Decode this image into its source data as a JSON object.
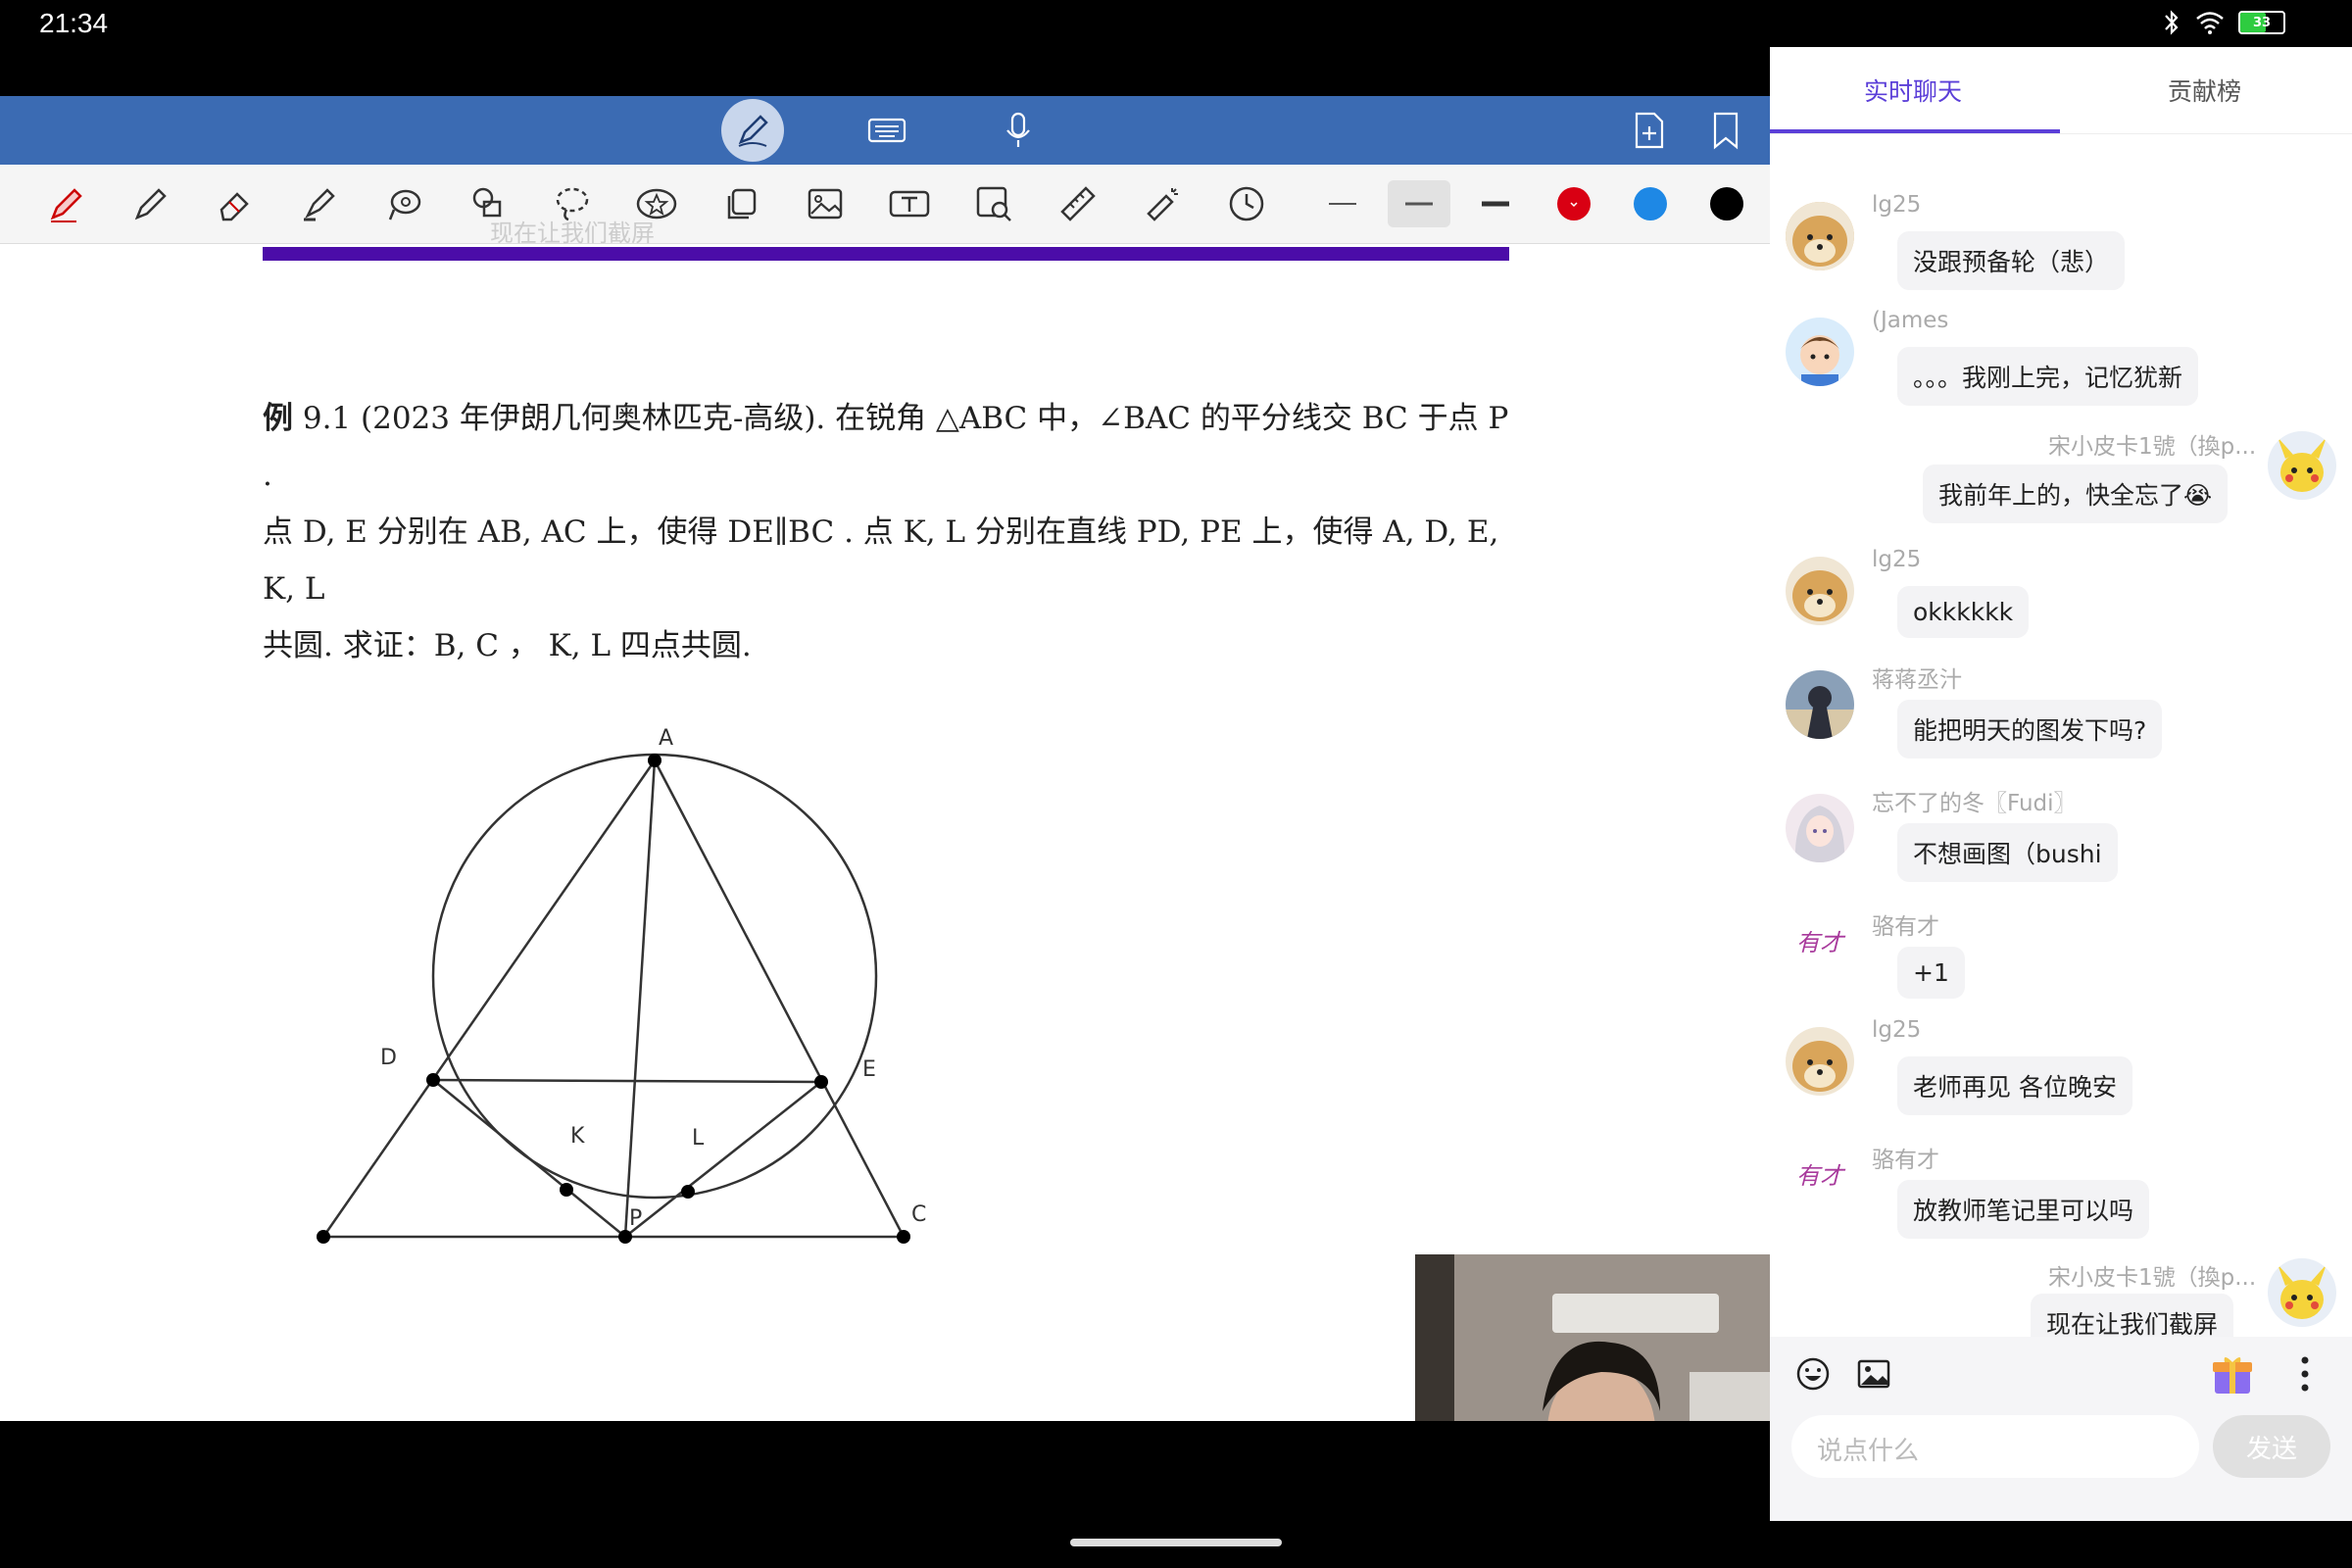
{
  "status": {
    "time": "21:34",
    "battery": "33"
  },
  "problem": {
    "label": "例",
    "line1": " 9.1 (2023 年伊朗几何奥林匹克-高级). 在锐角 △ABC 中，∠BAC 的平分线交 BC 于点 P .",
    "line2": "点 D, E 分别在 AB, AC 上，使得 DE∥BC . 点 K, L 分别在直线 PD, PE 上，使得 A, D, E, K, L",
    "line3": "共圆. 求证：B, C ， K, L 四点共圆."
  },
  "ghost_text": "现在让我们截屏",
  "figure": {
    "A": "A",
    "D": "D",
    "E": "E",
    "K": "K",
    "L": "L",
    "P": "P",
    "C": "C"
  },
  "chat": {
    "tabs": [
      "实时聊天",
      "贡献榜"
    ],
    "messages": [
      {
        "name": "lg25",
        "text": "没跟预备轮（悲）",
        "side": "left",
        "avatar": "doge"
      },
      {
        "name": "(James",
        "text": "。。。我刚上完，记忆犹新",
        "side": "left",
        "avatar": "boy"
      },
      {
        "name": "宋小皮卡1號（換p...",
        "text": "我前年上的，快全忘了😭",
        "side": "right",
        "avatar": "pikachu"
      },
      {
        "name": "lg25",
        "text": "okkkkkk",
        "side": "left",
        "avatar": "doge"
      },
      {
        "name": "蒋蒋丞汁",
        "text": "能把明天的图发下吗?",
        "side": "left",
        "avatar": "anime"
      },
      {
        "name": "忘不了的冬〖Fudi〗",
        "text": "不想画图（bushi",
        "side": "left",
        "avatar": "girl"
      },
      {
        "name": "骆有才",
        "text": "+1",
        "side": "left",
        "avatar": "calligraphy"
      },
      {
        "name": "lg25",
        "text": "老师再见 各位晚安",
        "side": "left",
        "avatar": "doge"
      },
      {
        "name": "骆有才",
        "text": "放教师笔记里可以吗",
        "side": "left",
        "avatar": "calligraphy"
      },
      {
        "name": "宋小皮卡1號（換p...",
        "text": "现在让我们截屏",
        "side": "right",
        "avatar": "pikachu"
      }
    ],
    "avatar_text": "有才",
    "input_placeholder": "说点什么",
    "send_label": "发送"
  }
}
